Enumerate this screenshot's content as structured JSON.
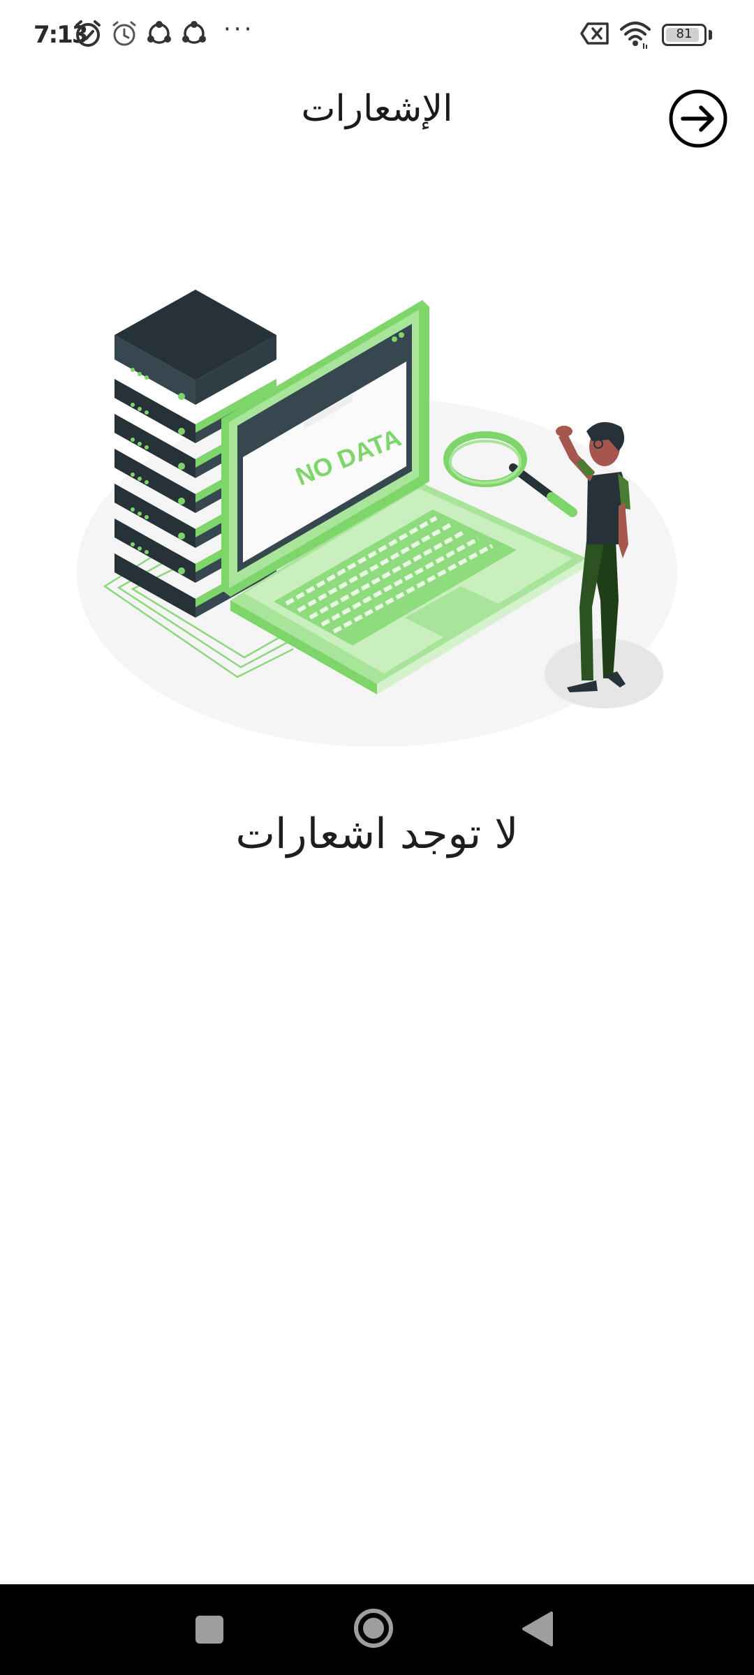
{
  "status_bar": {
    "time": "7:13",
    "battery_level": "81",
    "battery_fraction": 0.81,
    "overflow": "···",
    "icons": [
      "alarm-check-icon",
      "alarm-icon",
      "sync-icon",
      "sync-icon",
      "sim-off-icon",
      "wifi-icon",
      "battery-icon"
    ]
  },
  "header": {
    "title": "الإشعارات",
    "back_icon": "arrow-right-circle-icon"
  },
  "illustration": {
    "screen_text": "NO DATA",
    "accent_color": "#7ed66b",
    "dark_color": "#263238"
  },
  "empty_state": {
    "message": "لا توجد اشعارات"
  },
  "nav_bar": {
    "items": [
      "recents-icon",
      "home-icon",
      "back-triangle-icon"
    ]
  }
}
